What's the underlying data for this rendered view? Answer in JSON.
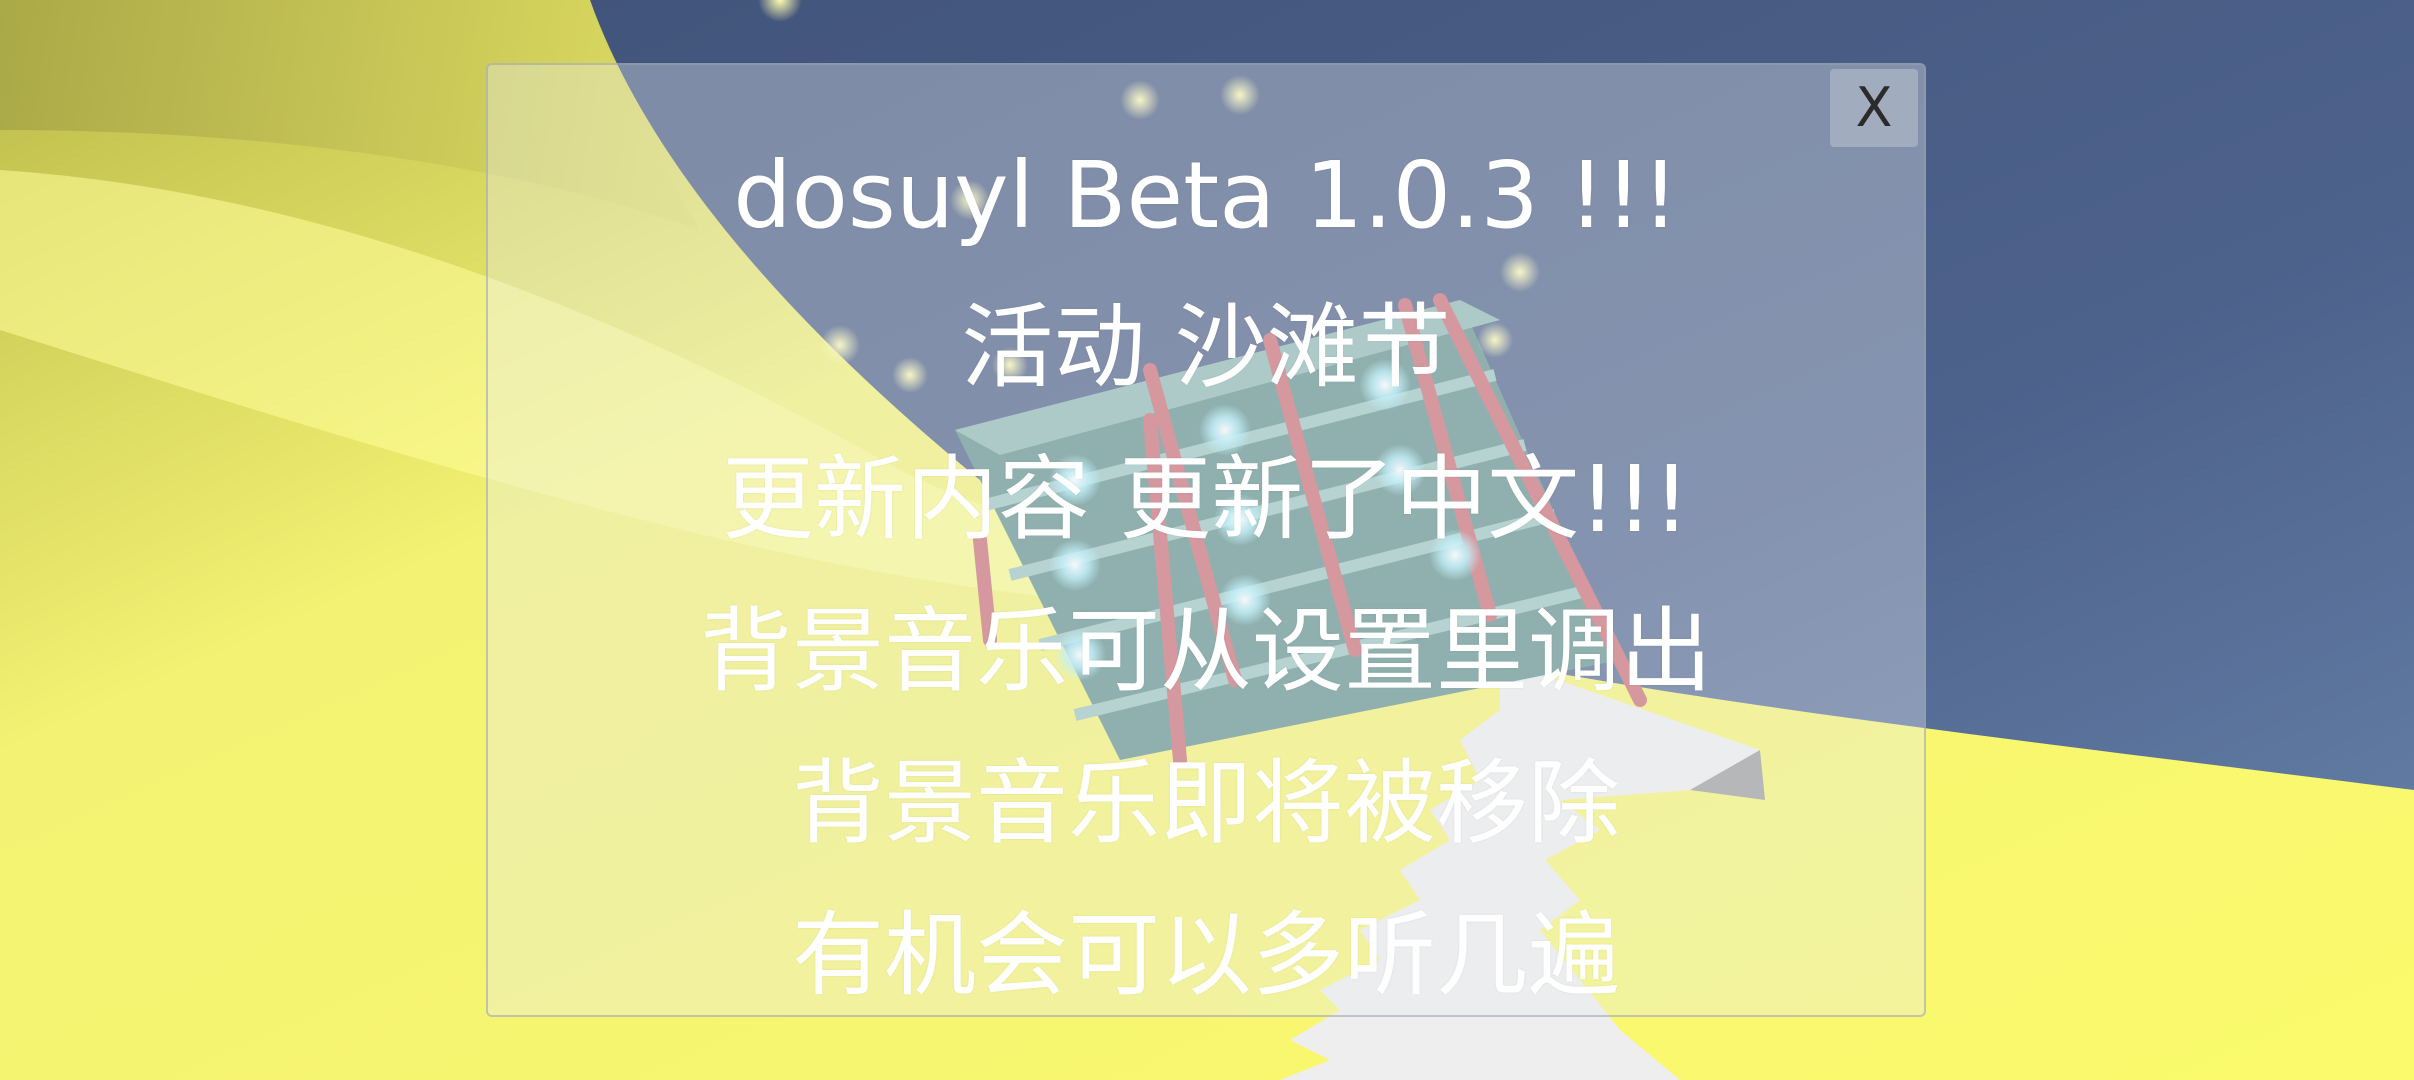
{
  "dialog": {
    "close_label": "X",
    "lines": [
      "dosuyl Beta 1.0.3 !!!",
      "活动 沙滩节",
      "更新内容 更新了中文!!!",
      "背景音乐可从设置里调出",
      "背景音乐即将被移除",
      "有机会可以多听几遍"
    ]
  },
  "colors": {
    "sky": "#4e6389",
    "sand_yellow": "#f7f56a",
    "dialog_overlay": "#e8ecf2",
    "platform_teal": "#6f9c98",
    "rail_red": "#c46a6f"
  }
}
